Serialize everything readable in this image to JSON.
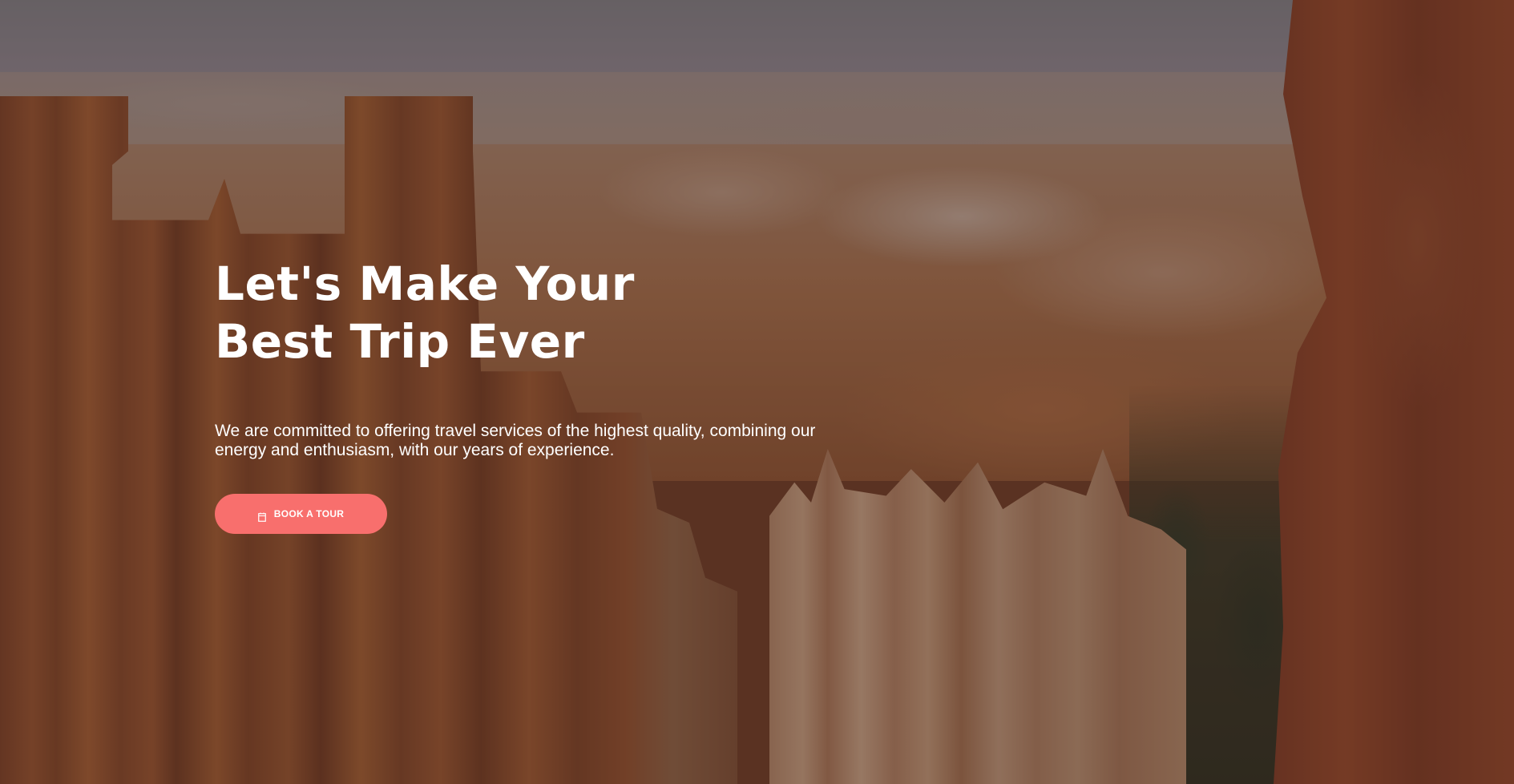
{
  "hero": {
    "headline_line1": "Let's Make Your",
    "headline_line2": "Best Trip Ever",
    "subtitle_line1": "We are committed to offering travel services of the highest quality, combining our",
    "subtitle_line2": "energy and enthusiasm, with our years of experience.",
    "cta_label": "BOOK A TOUR",
    "cta_icon": "calendar-icon",
    "accent_color": "#f86f6d",
    "background_image": "canyon-hoodoos-landscape"
  }
}
